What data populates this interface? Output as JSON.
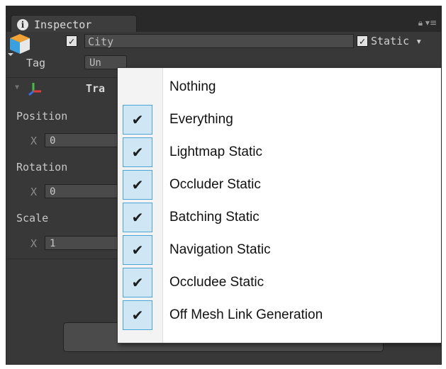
{
  "tab": {
    "icon": "info-icon",
    "label": "Inspector"
  },
  "tab_icons": {
    "lock": "lock-icon",
    "menu": "panel-menu-icon"
  },
  "object": {
    "active": true,
    "name": "City",
    "static_checked": true,
    "static_label": "Static"
  },
  "tag": {
    "label": "Tag",
    "value": "Un"
  },
  "transform": {
    "title": "Tra"
  },
  "position": {
    "label": "Position",
    "x_label": "X",
    "x": "0"
  },
  "rotation": {
    "label": "Rotation",
    "x_label": "X",
    "x": "0"
  },
  "scale": {
    "label": "Scale",
    "x_label": "X",
    "x": "1"
  },
  "static_menu": {
    "items": [
      {
        "label": "Nothing",
        "checked": false
      },
      {
        "label": "Everything",
        "checked": true
      },
      {
        "label": "Lightmap Static",
        "checked": true
      },
      {
        "label": "Occluder Static",
        "checked": true
      },
      {
        "label": "Batching Static",
        "checked": true
      },
      {
        "label": "Navigation Static",
        "checked": true
      },
      {
        "label": "Occludee Static",
        "checked": true
      },
      {
        "label": "Off Mesh Link Generation",
        "checked": true
      }
    ],
    "check_glyph": "✔"
  },
  "colors": {
    "panel_bg": "#383838",
    "menu_bg": "#ffffff",
    "check_bg": "#cfe7f5",
    "check_border": "#4aa5dc"
  }
}
